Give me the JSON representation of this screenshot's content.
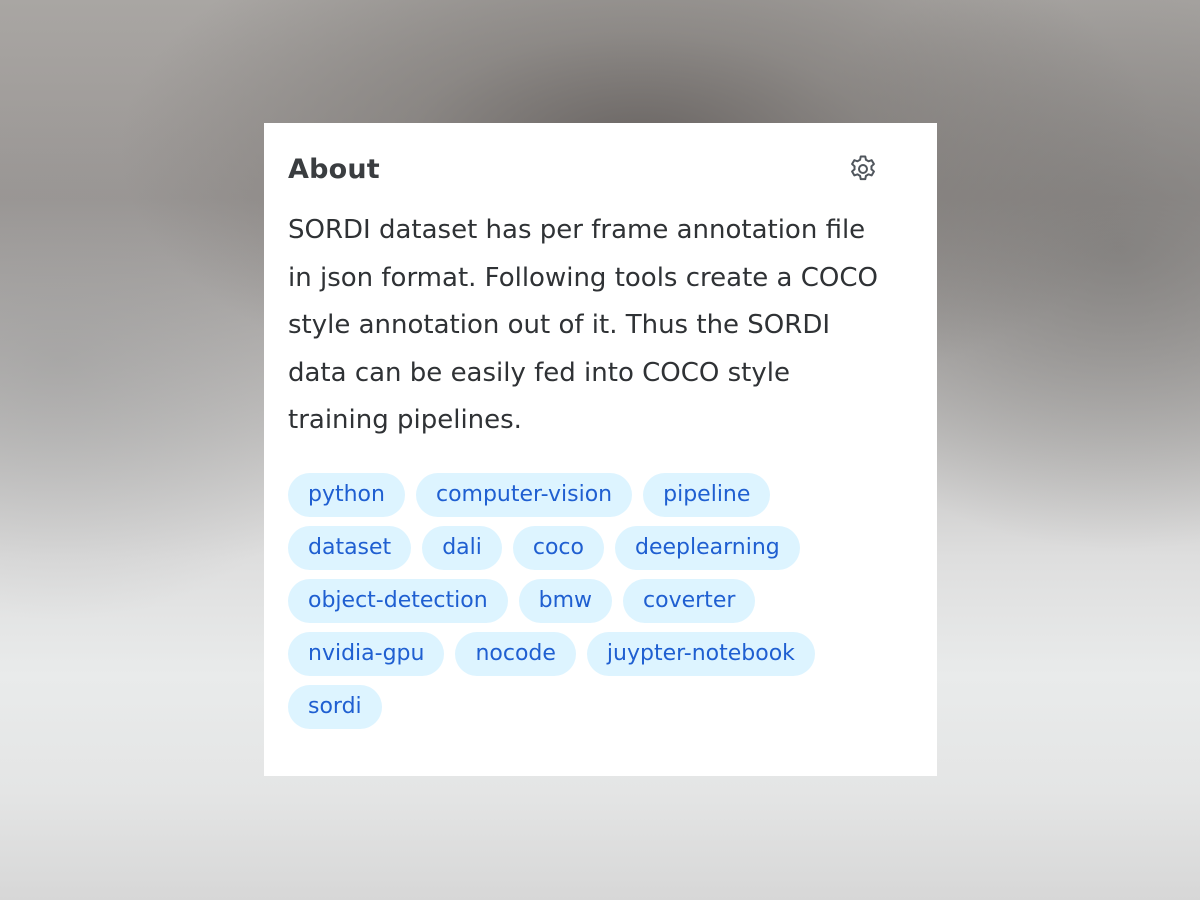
{
  "about": {
    "title": "About",
    "description": "SORDI dataset has per frame annotation file in json format. Following tools create a COCO style annotation out of it. Thus the SORDI data can be easily fed into COCO style training pipelines.",
    "settings_icon": "gear-icon",
    "topics": [
      "python",
      "computer-vision",
      "pipeline",
      "dataset",
      "dali",
      "coco",
      "deeplearning",
      "object-detection",
      "bmw",
      "coverter",
      "nvidia-gpu",
      "nocode",
      "juypter-notebook",
      "sordi"
    ]
  },
  "colors": {
    "tag_background": "#ddf4ff",
    "tag_text": "#1f5fd1",
    "title_text": "#3a3d40",
    "body_text": "#2f3235"
  }
}
